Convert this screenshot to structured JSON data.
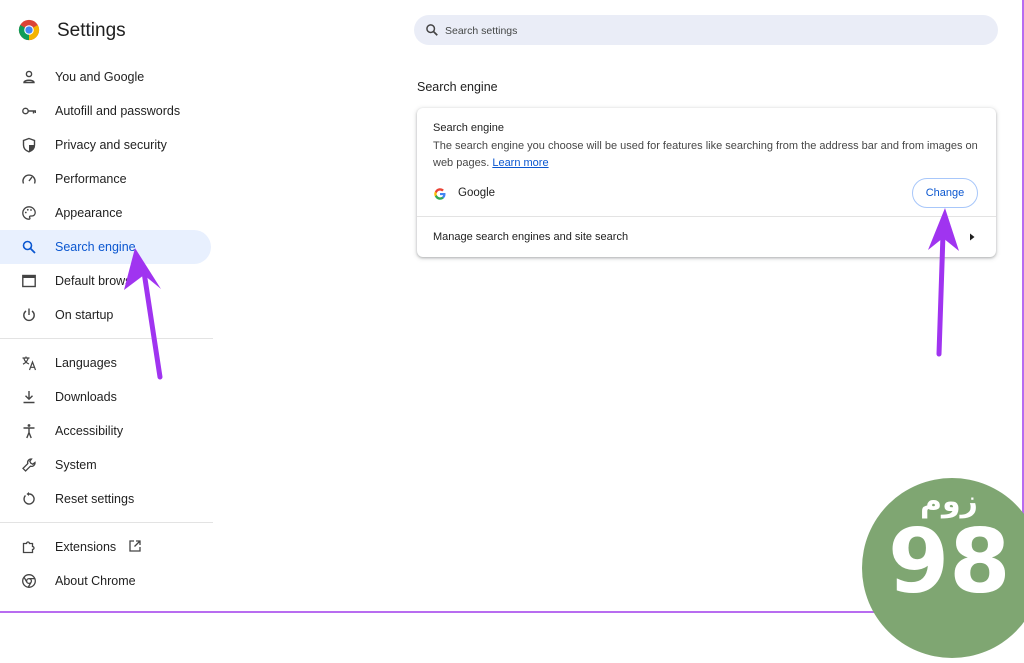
{
  "app": {
    "title": "Settings",
    "logo": "chrome-logo"
  },
  "search": {
    "placeholder": "Search settings",
    "value": ""
  },
  "sidebar": {
    "items": [
      {
        "label": "You and Google",
        "icon": "person-icon",
        "active": false
      },
      {
        "label": "Autofill and passwords",
        "icon": "key-icon",
        "active": false
      },
      {
        "label": "Privacy and security",
        "icon": "shield-icon",
        "active": false
      },
      {
        "label": "Performance",
        "icon": "speedometer-icon",
        "active": false
      },
      {
        "label": "Appearance",
        "icon": "palette-icon",
        "active": false
      },
      {
        "label": "Search engine",
        "icon": "search-icon",
        "active": true
      },
      {
        "label": "Default brows",
        "icon": "browser-window-icon",
        "active": false
      },
      {
        "label": "On startup",
        "icon": "power-icon",
        "active": false
      },
      {
        "label": "Languages",
        "icon": "translate-icon",
        "active": false
      },
      {
        "label": "Downloads",
        "icon": "download-icon",
        "active": false
      },
      {
        "label": "Accessibility",
        "icon": "accessibility-icon",
        "active": false
      },
      {
        "label": "System",
        "icon": "wrench-icon",
        "active": false
      },
      {
        "label": "Reset settings",
        "icon": "reset-icon",
        "active": false
      },
      {
        "label": "Extensions",
        "icon": "puzzle-icon",
        "active": false
      },
      {
        "label": "About Chrome",
        "icon": "chrome-icon",
        "active": false
      }
    ]
  },
  "main": {
    "section_title": "Search engine",
    "card": {
      "heading": "Search engine",
      "description": "The search engine you choose will be used for features like searching from the address bar and from images on web pages.",
      "learn_more": "Learn more",
      "engine_name": "Google",
      "change_label": "Change",
      "manage_label": "Manage search engines and site search"
    }
  },
  "watermark": {
    "text_top": "زوم",
    "text_bottom": "98"
  },
  "colors": {
    "accent": "#0b57d0",
    "active_bg": "#e8f0fe",
    "annotation_arrow": "#a034f0",
    "watermark_green": "#7fa672"
  }
}
